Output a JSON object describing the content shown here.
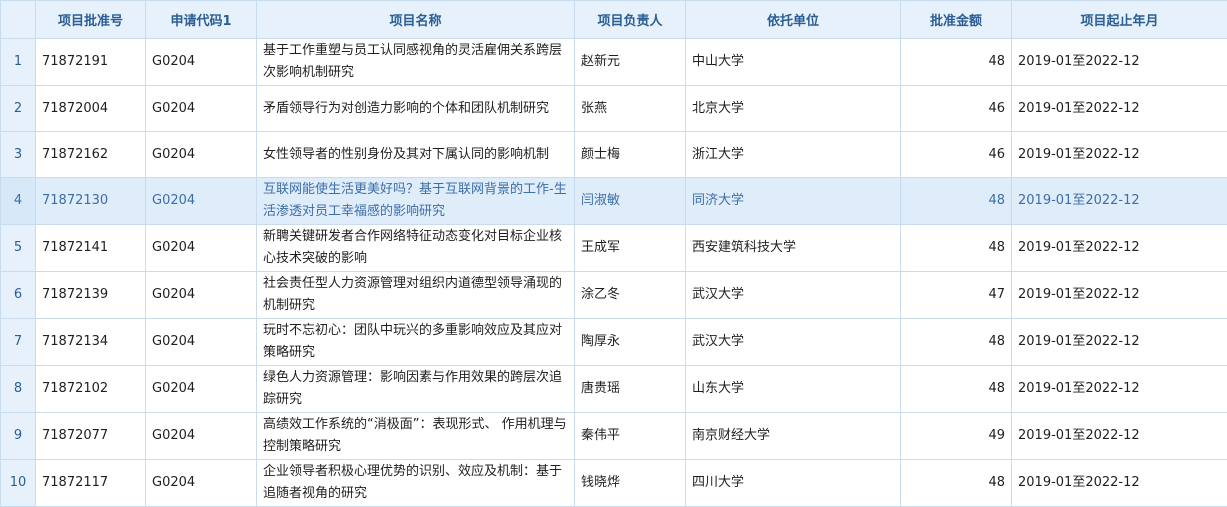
{
  "table": {
    "columns": [
      "项目批准号",
      "申请代码1",
      "项目名称",
      "项目负责人",
      "依托单位",
      "批准金额",
      "项目起止年月"
    ],
    "selected_row": 4,
    "rows": [
      {
        "num": "1",
        "approval_no": "71872191",
        "code": "G0204",
        "name": "基于工作重塑与员工认同感视角的灵活雇佣关系跨层次影响机制研究",
        "leader": "赵新元",
        "unit": "中山大学",
        "amount": "48",
        "period": "2019-01至2022-12"
      },
      {
        "num": "2",
        "approval_no": "71872004",
        "code": "G0204",
        "name": "矛盾领导行为对创造力影响的个体和团队机制研究",
        "leader": "张燕",
        "unit": "北京大学",
        "amount": "46",
        "period": "2019-01至2022-12"
      },
      {
        "num": "3",
        "approval_no": "71872162",
        "code": "G0204",
        "name": "女性领导者的性别身份及其对下属认同的影响机制",
        "leader": "颜士梅",
        "unit": "浙江大学",
        "amount": "46",
        "period": "2019-01至2022-12"
      },
      {
        "num": "4",
        "approval_no": "71872130",
        "code": "G0204",
        "name": "互联网能使生活更美好吗？基于互联网背景的工作-生活渗透对员工幸福感的影响研究",
        "leader": "闫淑敏",
        "unit": "同济大学",
        "amount": "48",
        "period": "2019-01至2022-12"
      },
      {
        "num": "5",
        "approval_no": "71872141",
        "code": "G0204",
        "name": "新聘关键研发者合作网络特征动态变化对目标企业核心技术突破的影响",
        "leader": "王成军",
        "unit": "西安建筑科技大学",
        "amount": "48",
        "period": "2019-01至2022-12"
      },
      {
        "num": "6",
        "approval_no": "71872139",
        "code": "G0204",
        "name": "社会责任型人力资源管理对组织内道德型领导涌现的机制研究",
        "leader": "涂乙冬",
        "unit": "武汉大学",
        "amount": "47",
        "period": "2019-01至2022-12"
      },
      {
        "num": "7",
        "approval_no": "71872134",
        "code": "G0204",
        "name": "玩时不忘初心：团队中玩兴的多重影响效应及其应对策略研究",
        "leader": "陶厚永",
        "unit": "武汉大学",
        "amount": "48",
        "period": "2019-01至2022-12"
      },
      {
        "num": "8",
        "approval_no": "71872102",
        "code": "G0204",
        "name": "绿色人力资源管理：影响因素与作用效果的跨层次追踪研究",
        "leader": "唐贵瑶",
        "unit": "山东大学",
        "amount": "48",
        "period": "2019-01至2022-12"
      },
      {
        "num": "9",
        "approval_no": "71872077",
        "code": "G0204",
        "name": "高绩效工作系统的“消极面”：表现形式、 作用机理与控制策略研究",
        "leader": "秦伟平",
        "unit": "南京财经大学",
        "amount": "49",
        "period": "2019-01至2022-12"
      },
      {
        "num": "10",
        "approval_no": "71872117",
        "code": "G0204",
        "name": "企业领导者积极心理优势的识别、效应及机制：基于追随者视角的研究",
        "leader": "钱晓烨",
        "unit": "四川大学",
        "amount": "48",
        "period": "2019-01至2022-12"
      }
    ]
  }
}
